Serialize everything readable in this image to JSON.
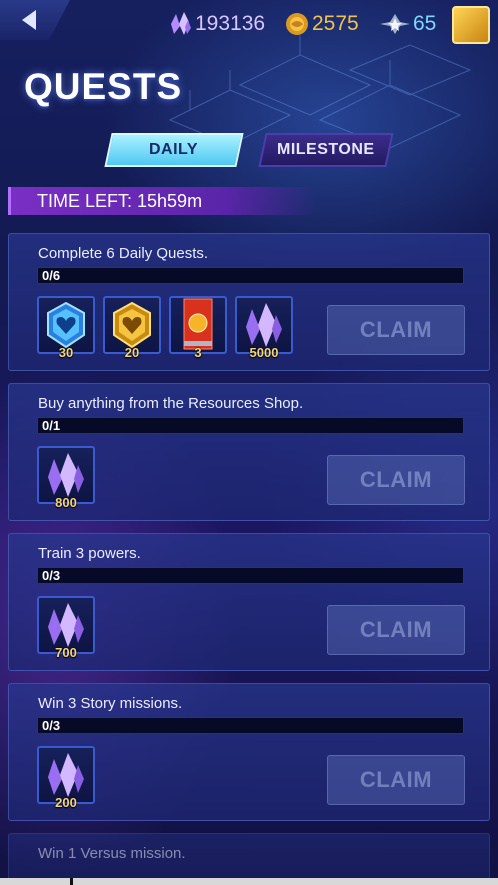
{
  "header": {
    "resources": {
      "crystals": "193136",
      "gold": "2575",
      "stars": "65"
    },
    "title": "QUESTS"
  },
  "tabs": [
    {
      "label": "DAILY",
      "active": true
    },
    {
      "label": "MILESTONE",
      "active": false
    }
  ],
  "time_left": "TIME LEFT: 15h59m",
  "quests": [
    {
      "title": "Complete 6 Daily Quests.",
      "progress_text": "0/6",
      "progress": 0,
      "rewards": [
        {
          "icon": "blue-heart-badge-icon",
          "count": "30"
        },
        {
          "icon": "gold-heart-badge-icon",
          "count": "20"
        },
        {
          "icon": "gold-orb-card-icon",
          "count": "3"
        },
        {
          "icon": "crystal-icon",
          "count": "5000"
        }
      ],
      "claim_label": "CLAIM"
    },
    {
      "title": "Buy anything from the Resources Shop.",
      "progress_text": "0/1",
      "progress": 0,
      "rewards": [
        {
          "icon": "crystal-icon",
          "count": "800"
        }
      ],
      "claim_label": "CLAIM"
    },
    {
      "title": "Train 3 powers.",
      "progress_text": "0/3",
      "progress": 0,
      "rewards": [
        {
          "icon": "crystal-icon",
          "count": "700"
        }
      ],
      "claim_label": "CLAIM"
    },
    {
      "title": "Win 3 Story missions.",
      "progress_text": "0/3",
      "progress": 0,
      "rewards": [
        {
          "icon": "crystal-icon",
          "count": "200"
        }
      ],
      "claim_label": "CLAIM"
    },
    {
      "title": "Win 1 Versus mission.",
      "progress_text": "",
      "progress": 0,
      "rewards": [],
      "claim_label": ""
    }
  ],
  "colors": {
    "accent_cyan": "#4fc8f2",
    "timeleft_purple": "#7a2fc4",
    "gold_text": "#f3c24a"
  }
}
